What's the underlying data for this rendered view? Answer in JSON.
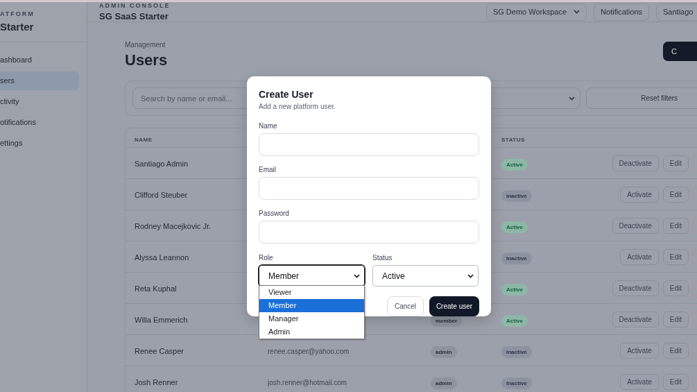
{
  "sidebar": {
    "brand_kicker": "ATFORM",
    "brand": "Starter",
    "items": [
      {
        "label": "ashboard",
        "selected": false
      },
      {
        "label": "sers",
        "selected": true
      },
      {
        "label": "ctivity",
        "selected": false
      },
      {
        "label": "otifications",
        "selected": false
      },
      {
        "label": "ettings",
        "selected": false
      }
    ]
  },
  "header": {
    "kicker": "ADMIN CONSOLE",
    "title": "SG SaaS Starter",
    "workspace": "SG Demo Workspace",
    "notifications": "Notifications",
    "user": "Santiago"
  },
  "page": {
    "breadcrumb": "Management",
    "title": "Users",
    "create_button": "C"
  },
  "filters": {
    "search_placeholder": "Search by name or email...",
    "reset": "Reset filters"
  },
  "table": {
    "name_heading": "NAME",
    "status_heading": "STATUS",
    "rows": [
      {
        "name": "Santiago Admin",
        "status": "Active",
        "active": true,
        "action": "Deactivate",
        "edit": "Edit"
      },
      {
        "name": "Clifford Steuber",
        "status": "Inactive",
        "active": false,
        "action": "Activate",
        "edit": "Edit"
      },
      {
        "name": "Rodney Macejkovic Jr.",
        "status": "Active",
        "active": true,
        "action": "Deactivate",
        "edit": "Edit"
      },
      {
        "name": "Alyssa Leannon",
        "status": "Inactive",
        "active": false,
        "action": "Activate",
        "edit": "Edit"
      },
      {
        "name": "Reta Kuphal",
        "status": "Active",
        "active": true,
        "action": "Deactivate",
        "edit": "Edit"
      },
      {
        "name": "Willa Emmerich",
        "role": "member",
        "status": "Active",
        "active": true,
        "action": "Deactivate",
        "edit": "Edit"
      },
      {
        "name": "Renee Casper",
        "email": "renee.casper@yahoo.com",
        "role": "admin",
        "status": "Inactive",
        "active": false,
        "action": "Activate",
        "edit": "Edit"
      },
      {
        "name": "Josh Renner",
        "email": "josh.renner@hotmail.com",
        "role": "admin",
        "status": "Inactive",
        "active": false,
        "action": "Activate",
        "edit": "Edit"
      }
    ]
  },
  "modal": {
    "title": "Create User",
    "subtitle": "Add a new platform user.",
    "fields": [
      {
        "label": "Name"
      },
      {
        "label": "Email"
      },
      {
        "label": "Password"
      }
    ],
    "role": {
      "label": "Role",
      "value": "Member",
      "options": [
        {
          "label": "Viewer",
          "selected": false
        },
        {
          "label": "Member",
          "selected": true
        },
        {
          "label": "Manager",
          "selected": false
        },
        {
          "label": "Admin",
          "selected": false
        }
      ]
    },
    "status": {
      "label": "Status",
      "value": "Active"
    },
    "cancel": "Cancel",
    "submit": "Create user"
  }
}
